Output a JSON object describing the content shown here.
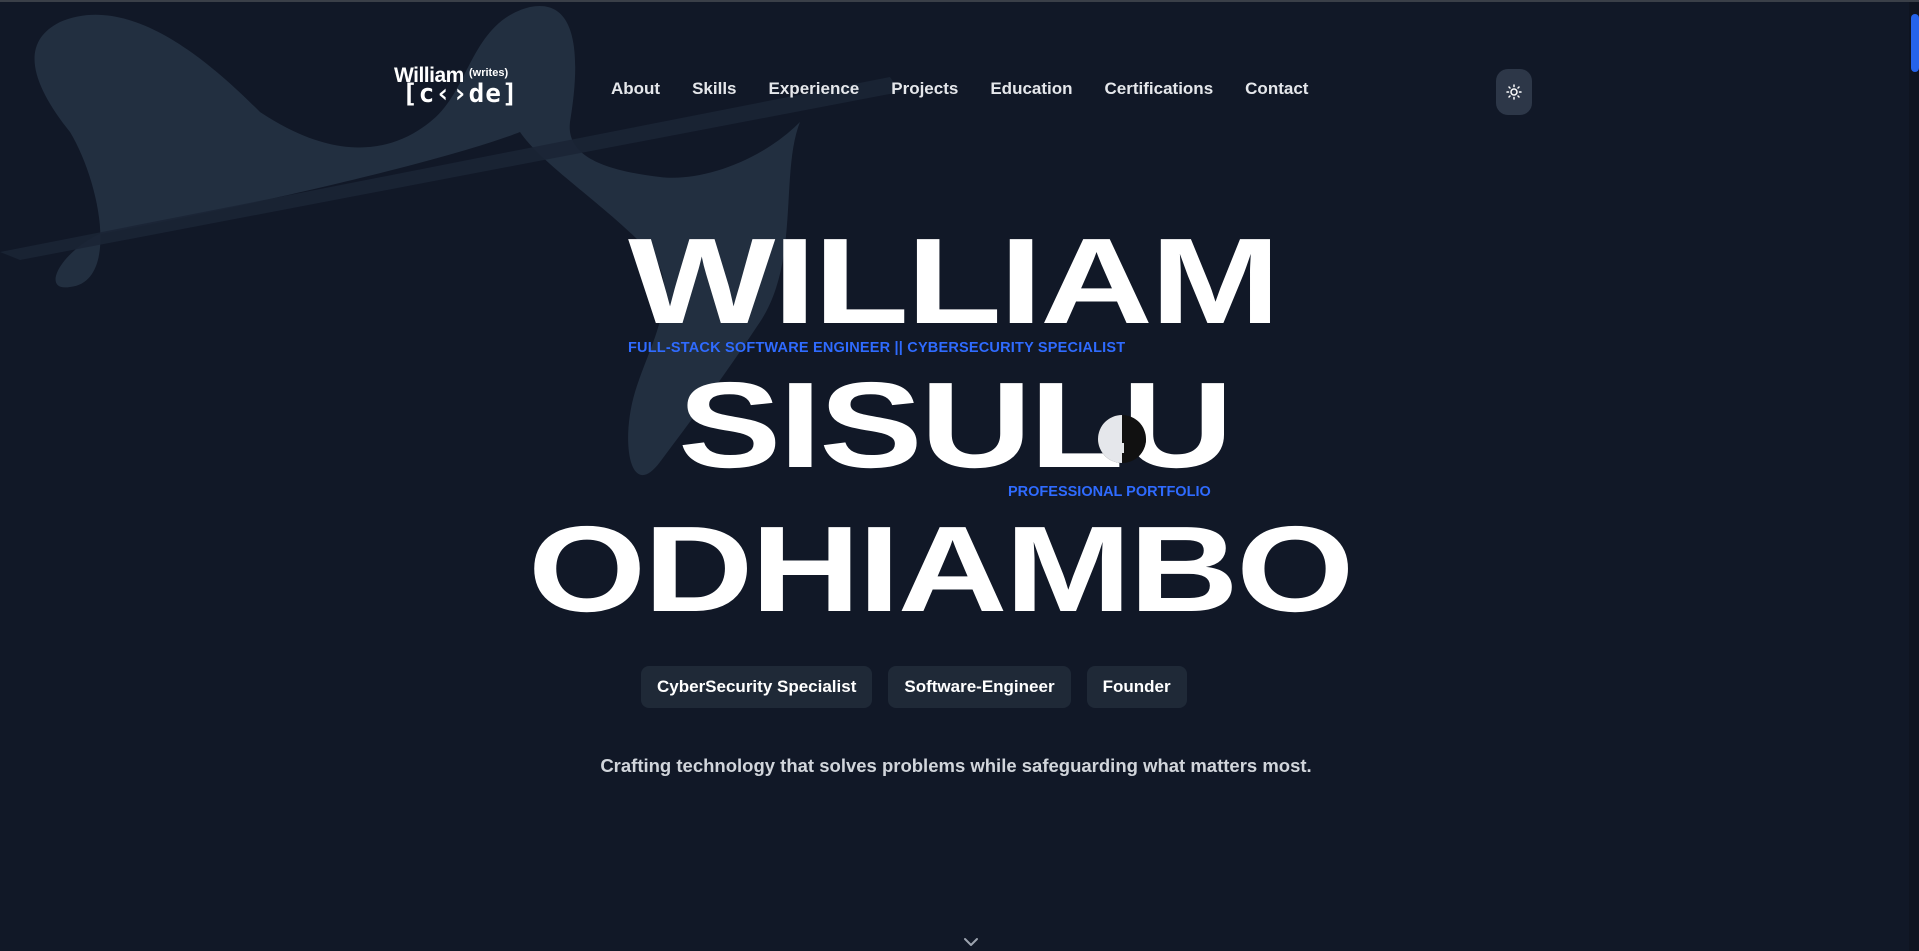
{
  "logo": {
    "name": "William",
    "writes": "(writes)",
    "code": "[c‹›de]"
  },
  "nav": {
    "items": [
      "About",
      "Skills",
      "Experience",
      "Projects",
      "Education",
      "Certifications",
      "Contact"
    ]
  },
  "theme_toggle": {
    "icon": "sun-icon"
  },
  "hero": {
    "first_name": "WILLIAM",
    "middle_name": "SISULU",
    "last_name": "ODHIAMBO",
    "subtitle_role": "FULL-STACK SOFTWARE ENGINEER || CYBERSECURITY SPECIALIST",
    "subtitle_portfolio": "PROFESSIONAL PORTFOLIO"
  },
  "badges": [
    "CyberSecurity Specialist",
    "Software-Engineer",
    "Founder"
  ],
  "tagline": "Crafting technology that solves problems while safeguarding what matters most.",
  "scroll_indicator": {
    "icon": "chevron-down-icon"
  },
  "colors": {
    "background": "#111827",
    "accent": "#2f6bff",
    "badge_bg": "#1f2937",
    "shape": "#253040"
  }
}
